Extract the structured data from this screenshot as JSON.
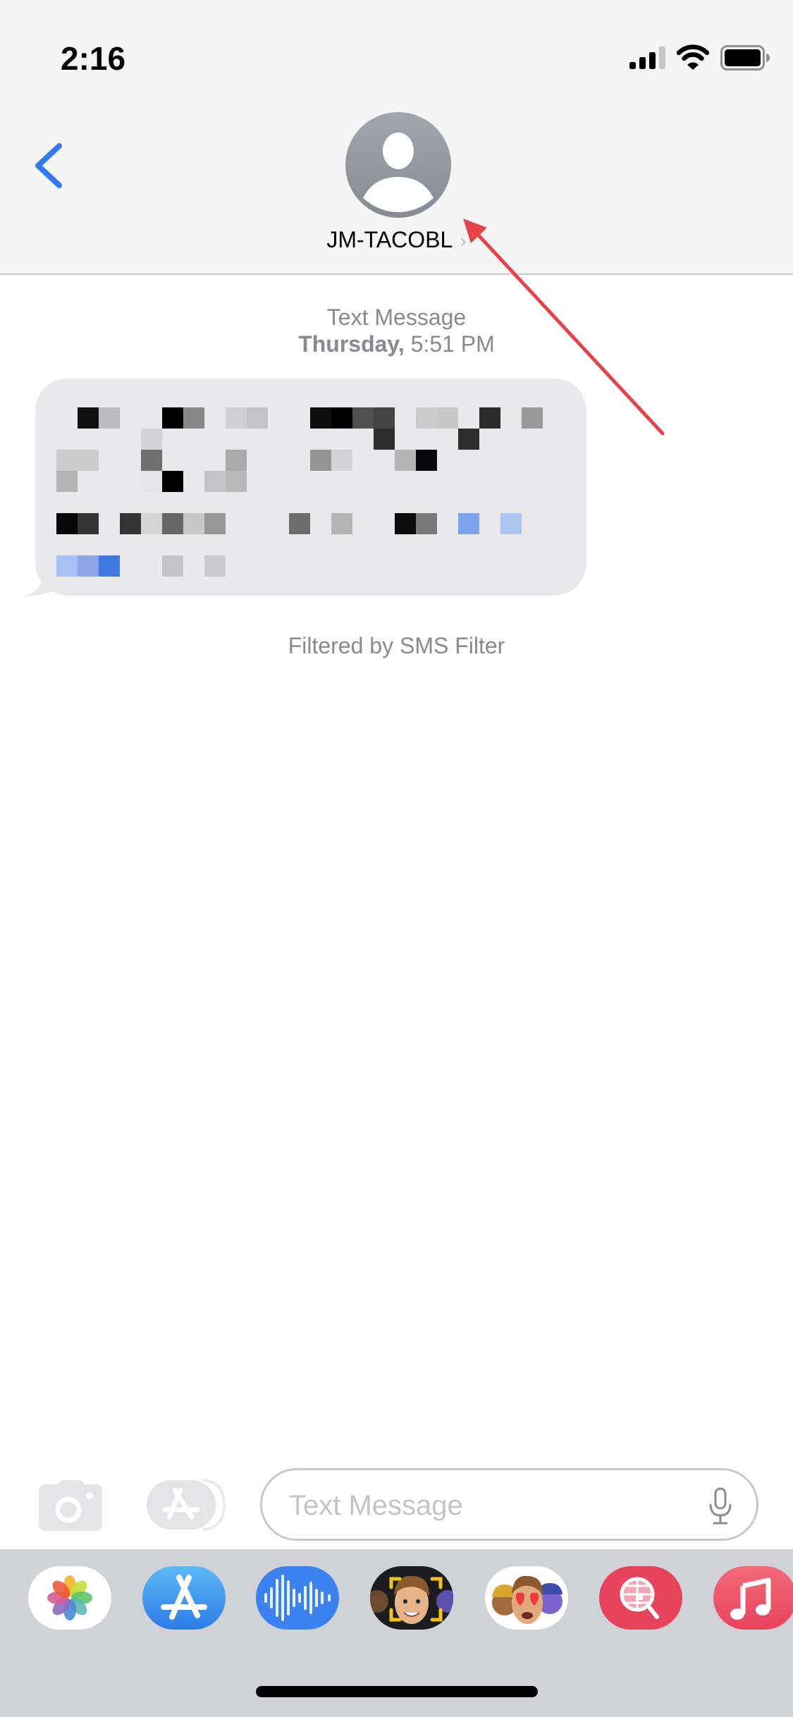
{
  "status_bar": {
    "time": "2:16",
    "signal_icon": "cellular-signal-icon",
    "signal_bars_active": 3,
    "signal_bars_total": 4,
    "wifi_icon": "wifi-icon",
    "battery_icon": "battery-icon"
  },
  "header": {
    "back_icon": "chevron-left-icon",
    "avatar_icon": "person-silhouette-icon",
    "contact_name": "JM-TACOBL",
    "contact_chevron": "›"
  },
  "conversation": {
    "message_type": "Text Message",
    "day": "Thursday,",
    "time": "5:51 PM",
    "message_content": "[pixelated / redacted]",
    "filter_note": "Filtered by SMS Filter"
  },
  "composer": {
    "camera_icon": "camera-icon",
    "apps_icon": "app-store-icon",
    "placeholder": "Text Message",
    "value": "",
    "mic_icon": "microphone-icon"
  },
  "app_drawer": {
    "apps": [
      {
        "name": "Photos",
        "icon": "photos-icon"
      },
      {
        "name": "App Store",
        "icon": "app-store-icon"
      },
      {
        "name": "Audio Message",
        "icon": "soundwave-icon"
      },
      {
        "name": "Memoji",
        "icon": "memoji-icon"
      },
      {
        "name": "Memoji Stickers",
        "icon": "memoji-stickers-icon"
      },
      {
        "name": "Images Search",
        "icon": "globe-search-icon"
      },
      {
        "name": "Music",
        "icon": "music-note-icon"
      }
    ]
  },
  "annotation": {
    "type": "arrow",
    "color": "#e5434a",
    "points_to": "contact-avatar"
  },
  "colors": {
    "accent": "#3478f6",
    "header_bg": "#f5f5f5",
    "bubble_bg": "#e9e9eb",
    "meta_text": "#8a8a8e",
    "dock_bg": "#d1d2d7"
  }
}
